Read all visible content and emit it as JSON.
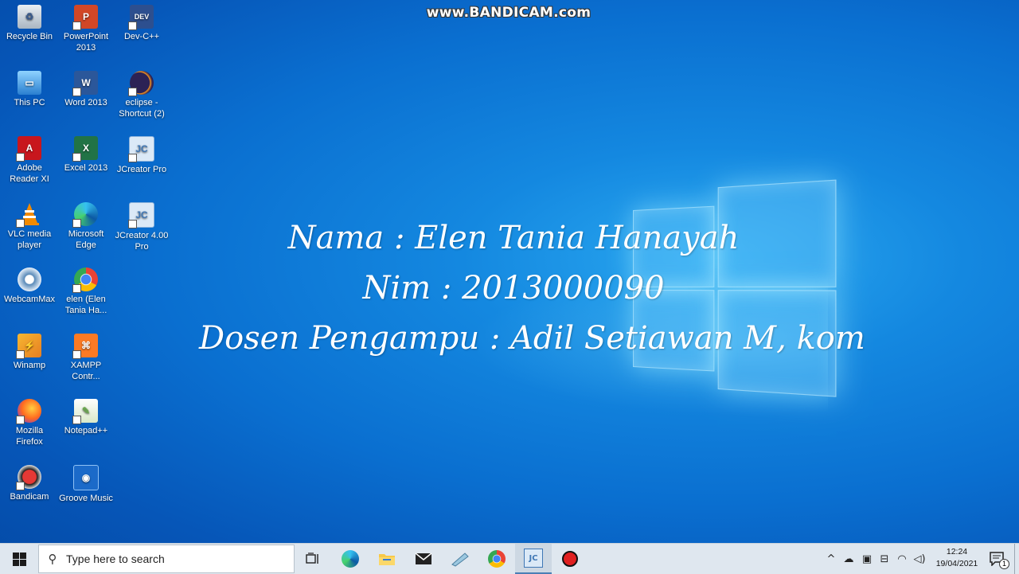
{
  "watermark": "www.BANDICAM.com",
  "overlay": {
    "line1": "Nama :  Elen Tania Hanayah",
    "line2": "Nim : 2013000090",
    "line3": "Dosen Pengampu : Adil Setiawan M, kom"
  },
  "desktop_icons": {
    "recycle_bin": "Recycle Bin",
    "powerpoint": "PowerPoint 2013",
    "devcpp": "Dev-C++",
    "this_pc": "This PC",
    "word": "Word 2013",
    "eclipse": "eclipse - Shortcut (2)",
    "adobe": "Adobe Reader XI",
    "excel": "Excel 2013",
    "jcreator_pro": "JCreator Pro",
    "vlc": "VLC media player",
    "edge": "Microsoft Edge",
    "jcreator_4": "JCreator 4.00 Pro",
    "webcammax": "WebcamMax",
    "chrome_profile": "elen (Elen Tania Ha...",
    "winamp": "Winamp",
    "xampp": "XAMPP Contr...",
    "firefox": "Mozilla Firefox",
    "notepadpp": "Notepad++",
    "bandicam": "Bandicam",
    "groove": "Groove Music"
  },
  "taskbar": {
    "search_placeholder": "Type here to search",
    "time": "12:24",
    "date": "19/04/2021",
    "notification_count": "1"
  },
  "colors": {
    "desktop_blue": "#0a6fd0",
    "taskbar_bg": "#dfe7ef"
  }
}
